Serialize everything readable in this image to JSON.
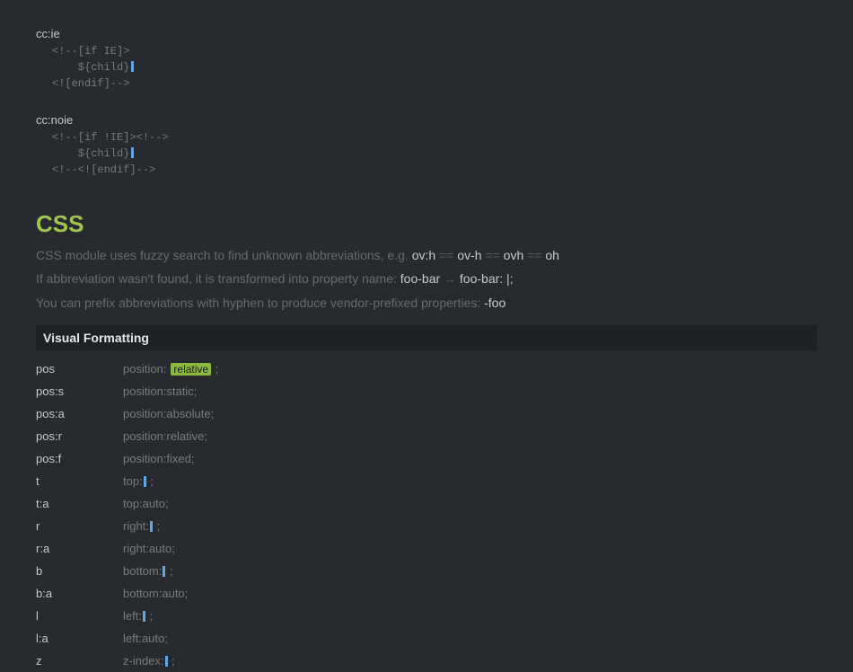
{
  "snippets": [
    {
      "name": "cc:ie",
      "lines": [
        {
          "text": "<!--[if IE]>"
        },
        {
          "text": "    ${child}",
          "cursor_after": true
        },
        {
          "text": "<![endif]-->"
        }
      ]
    },
    {
      "name": "cc:noie",
      "lines": [
        {
          "text": "<!--[if !IE]><!-->"
        },
        {
          "text": "    ${child}",
          "cursor_after": true
        },
        {
          "text": "<!--<![endif]-->"
        }
      ]
    }
  ],
  "css_heading": "CSS",
  "intro1": {
    "pre": "CSS module uses fuzzy search to find unknown abbreviations, e.g. ",
    "chain": [
      "ov:h",
      "ov-h",
      "ovh",
      "oh"
    ],
    "sep": " == "
  },
  "intro2": {
    "pre": "If abbreviation wasn't found, it is transformed into property name: ",
    "from": "foo-bar",
    "arrow": " → ",
    "to": "foo-bar: |;"
  },
  "intro3": {
    "pre": "You can prefix abbreviations with hyphen to produce vendor-prefixed properties: ",
    "ex": "-foo"
  },
  "section_title": "Visual Formatting",
  "rows": [
    {
      "abbr": "pos",
      "pre": "position:",
      "tabstop": "relative",
      "post": ";"
    },
    {
      "abbr": "pos:s",
      "expansion": "position:static;"
    },
    {
      "abbr": "pos:a",
      "expansion": "position:absolute;"
    },
    {
      "abbr": "pos:r",
      "expansion": "position:relative;"
    },
    {
      "abbr": "pos:f",
      "expansion": "position:fixed;"
    },
    {
      "abbr": "t",
      "pre": "top:",
      "cursor": true,
      "post": ";"
    },
    {
      "abbr": "t:a",
      "expansion": "top:auto;"
    },
    {
      "abbr": "r",
      "pre": "right:",
      "cursor": true,
      "post": ";"
    },
    {
      "abbr": "r:a",
      "expansion": "right:auto;"
    },
    {
      "abbr": "b",
      "pre": "bottom:",
      "cursor": true,
      "post": ";"
    },
    {
      "abbr": "b:a",
      "expansion": "bottom:auto;"
    },
    {
      "abbr": "l",
      "pre": "left:",
      "cursor": true,
      "post": ";"
    },
    {
      "abbr": "l:a",
      "expansion": "left:auto;"
    },
    {
      "abbr": "z",
      "pre": "z-index:",
      "cursor": true,
      "post": ";"
    }
  ]
}
